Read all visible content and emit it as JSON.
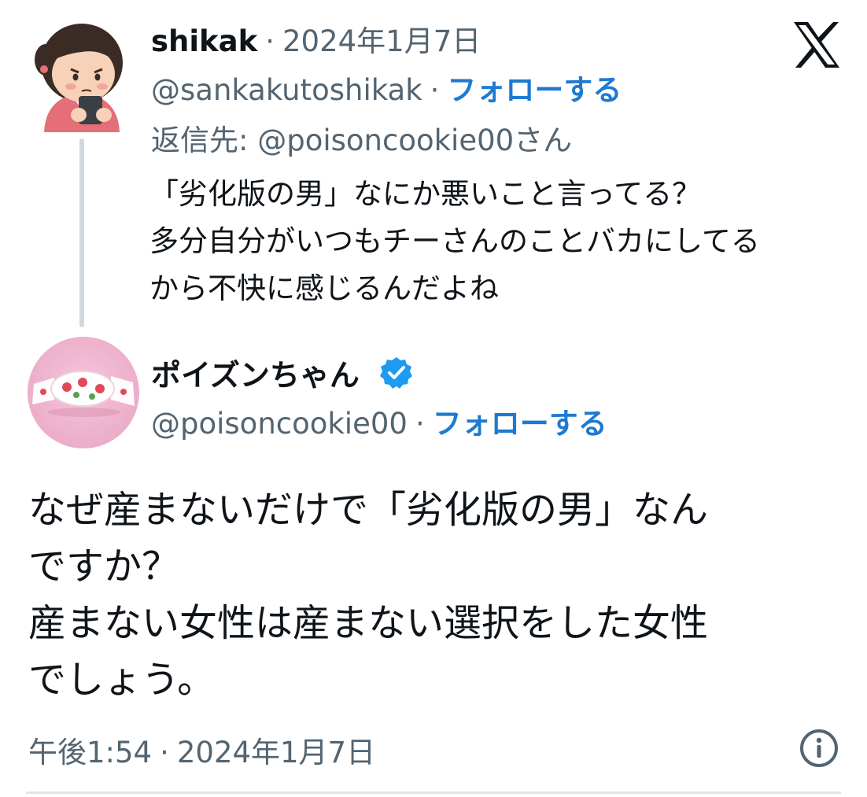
{
  "reply_tweet": {
    "display_name": "shikak",
    "separator": "·",
    "date": "2024年1月7日",
    "handle": "@sankakutoshikak",
    "follow_label": "フォローする",
    "reply_to": "返信先: @poisoncookie00さん",
    "text_lines": [
      "「劣化版の男」なにか悪いこと言ってる？",
      "多分自分がいつもチーさんのことバカにしてる",
      "から不快に感じるんだよね"
    ]
  },
  "main_tweet": {
    "display_name": "ポイズンちゃん",
    "verified": true,
    "handle": "@poisoncookie00",
    "separator": "·",
    "follow_label": "フォローする",
    "text_lines": [
      "なぜ産まないだけで「劣化版の男」なん",
      "ですか？",
      "産まない女性は産まない選択をした女性",
      "でしょう。"
    ],
    "time": "午後1:54",
    "date": "2024年1月7日"
  },
  "icons": {
    "brand": "x-logo-icon",
    "verified": "verified-badge-icon",
    "info": "info-icon"
  },
  "colors": {
    "follow": "#1d7ad0",
    "muted": "#536471",
    "verified": "#1d9bf0"
  }
}
